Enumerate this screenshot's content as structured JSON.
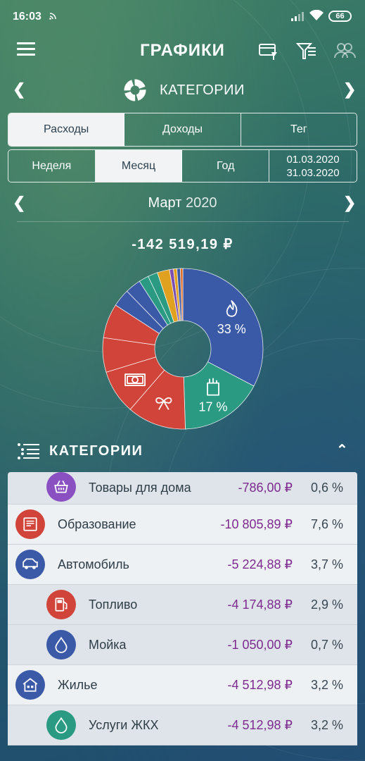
{
  "status": {
    "time": "16:03",
    "battery": "66"
  },
  "appbar": {
    "title": "ГРАФИКИ"
  },
  "category_nav": {
    "label": "КАТЕГОРИИ"
  },
  "type_tabs": [
    {
      "label": "Расходы",
      "active": true
    },
    {
      "label": "Доходы",
      "active": false
    },
    {
      "label": "Тег",
      "active": false
    }
  ],
  "period_tabs": [
    {
      "label": "Неделя",
      "active": false
    },
    {
      "label": "Месяц",
      "active": true
    },
    {
      "label": "Год",
      "active": false
    }
  ],
  "date_range": {
    "from": "01.03.2020",
    "to": "31.03.2020"
  },
  "month": {
    "name": "Март",
    "year": "2020"
  },
  "total": "-142 519,19 ₽",
  "chart_data": {
    "type": "pie",
    "donut": true,
    "slices": [
      {
        "value": 33,
        "color": "#3a5aa8",
        "label": "33 %",
        "icon": "fire-icon"
      },
      {
        "value": 17,
        "color": "#2a9a83",
        "label": "17 %",
        "icon": "grocery-bag-icon"
      },
      {
        "value": 12,
        "color": "#d0443a",
        "icon": "gift-bow-icon"
      },
      {
        "value": 9,
        "color": "#d0443a",
        "icon": "money-icon"
      },
      {
        "value": 7,
        "color": "#d0443a"
      },
      {
        "value": 7,
        "color": "#d0443a"
      },
      {
        "value": 3.6,
        "color": "#3a5aa8"
      },
      {
        "value": 3.2,
        "color": "#3a5aa8"
      },
      {
        "value": 2,
        "color": "#2a9a83"
      },
      {
        "value": 2,
        "color": "#2a9a83"
      },
      {
        "value": 2.5,
        "color": "#e0a020"
      },
      {
        "value": 0.8,
        "color": "#7a4fb0"
      },
      {
        "value": 0.7,
        "color": "#e0a020"
      },
      {
        "value": 0.7,
        "color": "#3a5aa8"
      },
      {
        "value": 0.5,
        "color": "#e06a20"
      }
    ]
  },
  "categories_header": {
    "label": "КАТЕГОРИИ"
  },
  "categories": [
    {
      "name": "Товары для дома",
      "amount": "-786,00 ₽",
      "percent": "0,6 %",
      "level": "child",
      "icon": "basket-icon",
      "color": "#8a4fc0"
    },
    {
      "name": "Образование",
      "amount": "-10 805,89 ₽",
      "percent": "7,6 %",
      "level": "parent",
      "icon": "certificate-icon",
      "color": "#d0443a"
    },
    {
      "name": "Автомобиль",
      "amount": "-5 224,88 ₽",
      "percent": "3,7 %",
      "level": "parent",
      "icon": "car-icon",
      "color": "#3a5aa8"
    },
    {
      "name": "Топливо",
      "amount": "-4 174,88 ₽",
      "percent": "2,9 %",
      "level": "child",
      "icon": "fuel-pump-icon",
      "color": "#d0443a"
    },
    {
      "name": "Мойка",
      "amount": "-1 050,00 ₽",
      "percent": "0,7 %",
      "level": "child",
      "icon": "water-drop-icon",
      "color": "#3a5aa8"
    },
    {
      "name": "Жилье",
      "amount": "-4 512,98 ₽",
      "percent": "3,2 %",
      "level": "parent",
      "icon": "house-icon",
      "color": "#3a5aa8"
    },
    {
      "name": "Услуги ЖКХ",
      "amount": "-4 512,98 ₽",
      "percent": "3,2 %",
      "level": "child",
      "icon": "water-drop-icon",
      "color": "#2a9a83"
    }
  ]
}
